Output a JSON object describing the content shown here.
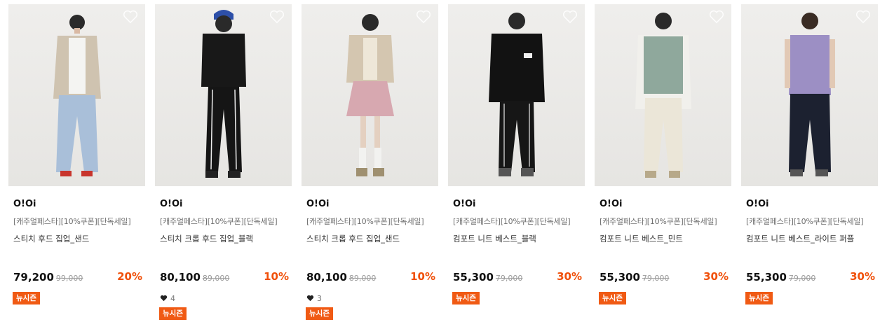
{
  "products": [
    {
      "brand": "O!Oi",
      "promo": "[캐주얼페스타][10%쿠폰][단독세일]",
      "name": "스티치 후드 집업_샌드",
      "price": "79,200",
      "original": "99,000",
      "discount": "20%",
      "likes": null,
      "badge": "뉴시즌"
    },
    {
      "brand": "O!Oi",
      "promo": "[캐주얼페스타][10%쿠폰][단독세일]",
      "name": "스티치 크롭 후드 집업_블랙",
      "price": "80,100",
      "original": "89,000",
      "discount": "10%",
      "likes": "4",
      "badge": "뉴시즌"
    },
    {
      "brand": "O!Oi",
      "promo": "[캐주얼페스타][10%쿠폰][단독세일]",
      "name": "스티치 크롭 후드 집업_샌드",
      "price": "80,100",
      "original": "89,000",
      "discount": "10%",
      "likes": "3",
      "badge": "뉴시즌"
    },
    {
      "brand": "O!Oi",
      "promo": "[캐주얼페스타][10%쿠폰][단독세일]",
      "name": "컴포트 니트 베스트_블랙",
      "price": "55,300",
      "original": "79,000",
      "discount": "30%",
      "likes": null,
      "badge": "뉴시즌"
    },
    {
      "brand": "O!Oi",
      "promo": "[캐주얼페스타][10%쿠폰][단독세일]",
      "name": "컴포트 니트 베스트_민트",
      "price": "55,300",
      "original": "79,000",
      "discount": "30%",
      "likes": null,
      "badge": "뉴시즌"
    },
    {
      "brand": "O!Oi",
      "promo": "[캐주얼페스타][10%쿠폰][단독세일]",
      "name": "컴포트 니트 베스트_라이트 퍼플",
      "price": "55,300",
      "original": "79,000",
      "discount": "30%",
      "likes": null,
      "badge": "뉴시즌"
    }
  ],
  "colors": {
    "accent": "#f05a14",
    "discount": "#f0500a"
  },
  "icons": {
    "wishlist": "heart-outline-icon",
    "likes": "heart-filled-icon"
  }
}
